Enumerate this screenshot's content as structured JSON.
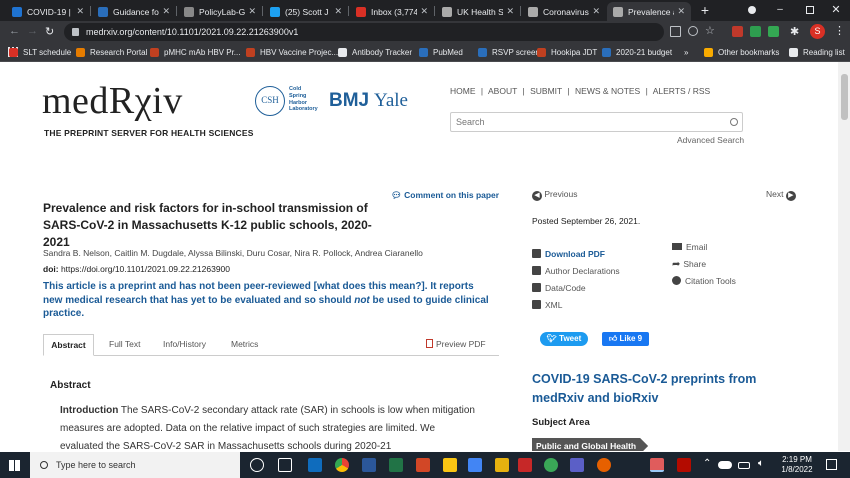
{
  "browser": {
    "tabs": [
      {
        "title": "COVID-19 | Pr",
        "color": "#1f73d1",
        "active": false
      },
      {
        "title": "Guidance for",
        "color": "#2a6ebb",
        "active": false
      },
      {
        "title": "PolicyLab-Gui",
        "color": "#888888",
        "active": false
      },
      {
        "title": "(25) Scott J B",
        "color": "#1da1f2",
        "active": false
      },
      {
        "title": "Inbox (3,774)",
        "color": "#d93025",
        "active": false
      },
      {
        "title": "UK Health Sec",
        "color": "#aaaaaa",
        "active": false
      },
      {
        "title": "Coronavirus (",
        "color": "#aaaaaa",
        "active": false
      },
      {
        "title": "Prevalence an",
        "color": "#aaaaaa",
        "active": true
      }
    ],
    "new_tab_label": "+",
    "url": "medrxiv.org/content/10.1101/2021.09.22.21263900v1",
    "profile_initial": "S",
    "bookmarks": [
      {
        "label": "SLT schedule",
        "color": "#d93025"
      },
      {
        "label": "Research Portal",
        "color": "#e67c00"
      },
      {
        "label": "pMHC mAb HBV Pr...",
        "color": "#c04020"
      },
      {
        "label": "HBV Vaccine Projec...",
        "color": "#c04020"
      },
      {
        "label": "Antibody Tracker",
        "color": "#e8eaed"
      },
      {
        "label": "PubMed",
        "color": "#2a6ebb"
      },
      {
        "label": "RSVP screen",
        "color": "#2a6ebb"
      },
      {
        "label": "Hookipa JDT",
        "color": "#c04020"
      },
      {
        "label": "2020-21 budget",
        "color": "#2a6ebb"
      }
    ],
    "more_bookmarks": "»",
    "other_bookmarks": "Other bookmarks",
    "reading_list": "Reading list"
  },
  "site": {
    "logo_text": "medRχiv",
    "tagline": "THE PREPRINT SERVER FOR HEALTH SCIENCES",
    "csh_initials": "CSH",
    "csh_lines": [
      "Cold",
      "Spring",
      "Harbor",
      "Laboratory"
    ],
    "bmj": "BMJ",
    "yale": "Yale",
    "nav": [
      "HOME",
      "ABOUT",
      "SUBMIT",
      "NEWS & NOTES",
      "ALERTS / RSS"
    ],
    "nav_sep": "|",
    "search_placeholder": "Search",
    "advanced_search": "Advanced Search"
  },
  "article": {
    "comment_link": "Comment on this paper",
    "title": "Prevalence and risk factors for in-school transmission of SARS-CoV-2 in Massachusetts K-12 public schools, 2020-2021",
    "authors": "Sandra B. Nelson, Caitlin M. Dugdale, Alyssa Bilinski, Duru Cosar, Nira R. Pollock, Andrea Ciaranello",
    "doi_label": "doi:",
    "doi": "https://doi.org/10.1101/2021.09.22.21263900",
    "notice_1": "This article is a preprint and has not been peer-reviewed [what does this mean?]. It reports new medical research that has yet to be evaluated and so should ",
    "notice_not": "not",
    "notice_2": " be used to guide clinical practice.",
    "tabs": [
      "Abstract",
      "Full Text",
      "Info/History",
      "Metrics"
    ],
    "preview_pdf": "Preview PDF",
    "abstract_heading": "Abstract",
    "intro_label": "Introduction",
    "intro_text": " The SARS-CoV-2 secondary attack rate (SAR) in schools is low when mitigation measures are adopted. Data on the relative impact of such strategies are limited. We evaluated the SARS-CoV-2 SAR in Massachusetts schools during 2020-21"
  },
  "sidebar": {
    "previous": "Previous",
    "next": "Next",
    "posted": "Posted September 26, 2021.",
    "download_pdf": "Download PDF",
    "author_declarations": "Author Declarations",
    "data_code": "Data/Code",
    "xml": "XML",
    "email": "Email",
    "share": "Share",
    "citation_tools": "Citation Tools",
    "tweet": "Tweet",
    "like": "Like 9",
    "covid_heading": "COVID-19 SARS-CoV-2 preprints from medRxiv and bioRxiv",
    "subject_area": "Subject Area",
    "subject_tag": "Public and Global Health"
  },
  "taskbar": {
    "search_placeholder": "Type here to search",
    "time": "2:19 PM",
    "date": "1/8/2022"
  }
}
